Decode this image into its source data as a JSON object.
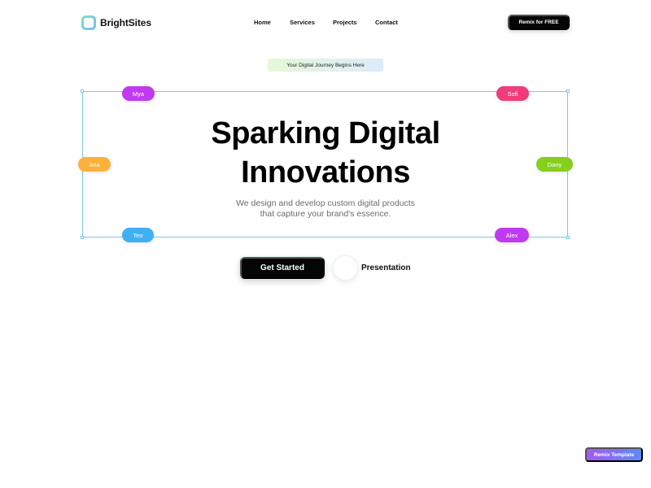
{
  "header": {
    "brand": "BrightSites",
    "nav": [
      {
        "label": "Home"
      },
      {
        "label": "Services"
      },
      {
        "label": "Projects"
      },
      {
        "label": "Contact"
      }
    ],
    "cta_label": "Remix for FREE"
  },
  "hero": {
    "tagline": "Your Digital Journey Begins Here",
    "title_line1": "Sparking Digital",
    "title_line2": "Innovations",
    "subtitle_line1": "We design and develop custom digital products",
    "subtitle_line2": "that capture your brand's essence.",
    "name_tags": [
      {
        "label": "Mya",
        "color": "#c03bef"
      },
      {
        "label": "Sofi",
        "color": "#f23b7a"
      },
      {
        "label": "Ana",
        "color": "#fbb13c"
      },
      {
        "label": "Dany",
        "color": "#86cf1c"
      },
      {
        "label": "Teo",
        "color": "#3eb0f3"
      },
      {
        "label": "Alex",
        "color": "#c03bef"
      }
    ],
    "primary_button": "Get Started",
    "secondary_button": "Presentation"
  },
  "badge": {
    "label": "Remix Template"
  },
  "colors": {
    "accent_dark": "#050505",
    "frame_line": "#7ec7ec",
    "badge_gradient_start": "#a458f2",
    "badge_gradient_end": "#5b8cf7"
  }
}
